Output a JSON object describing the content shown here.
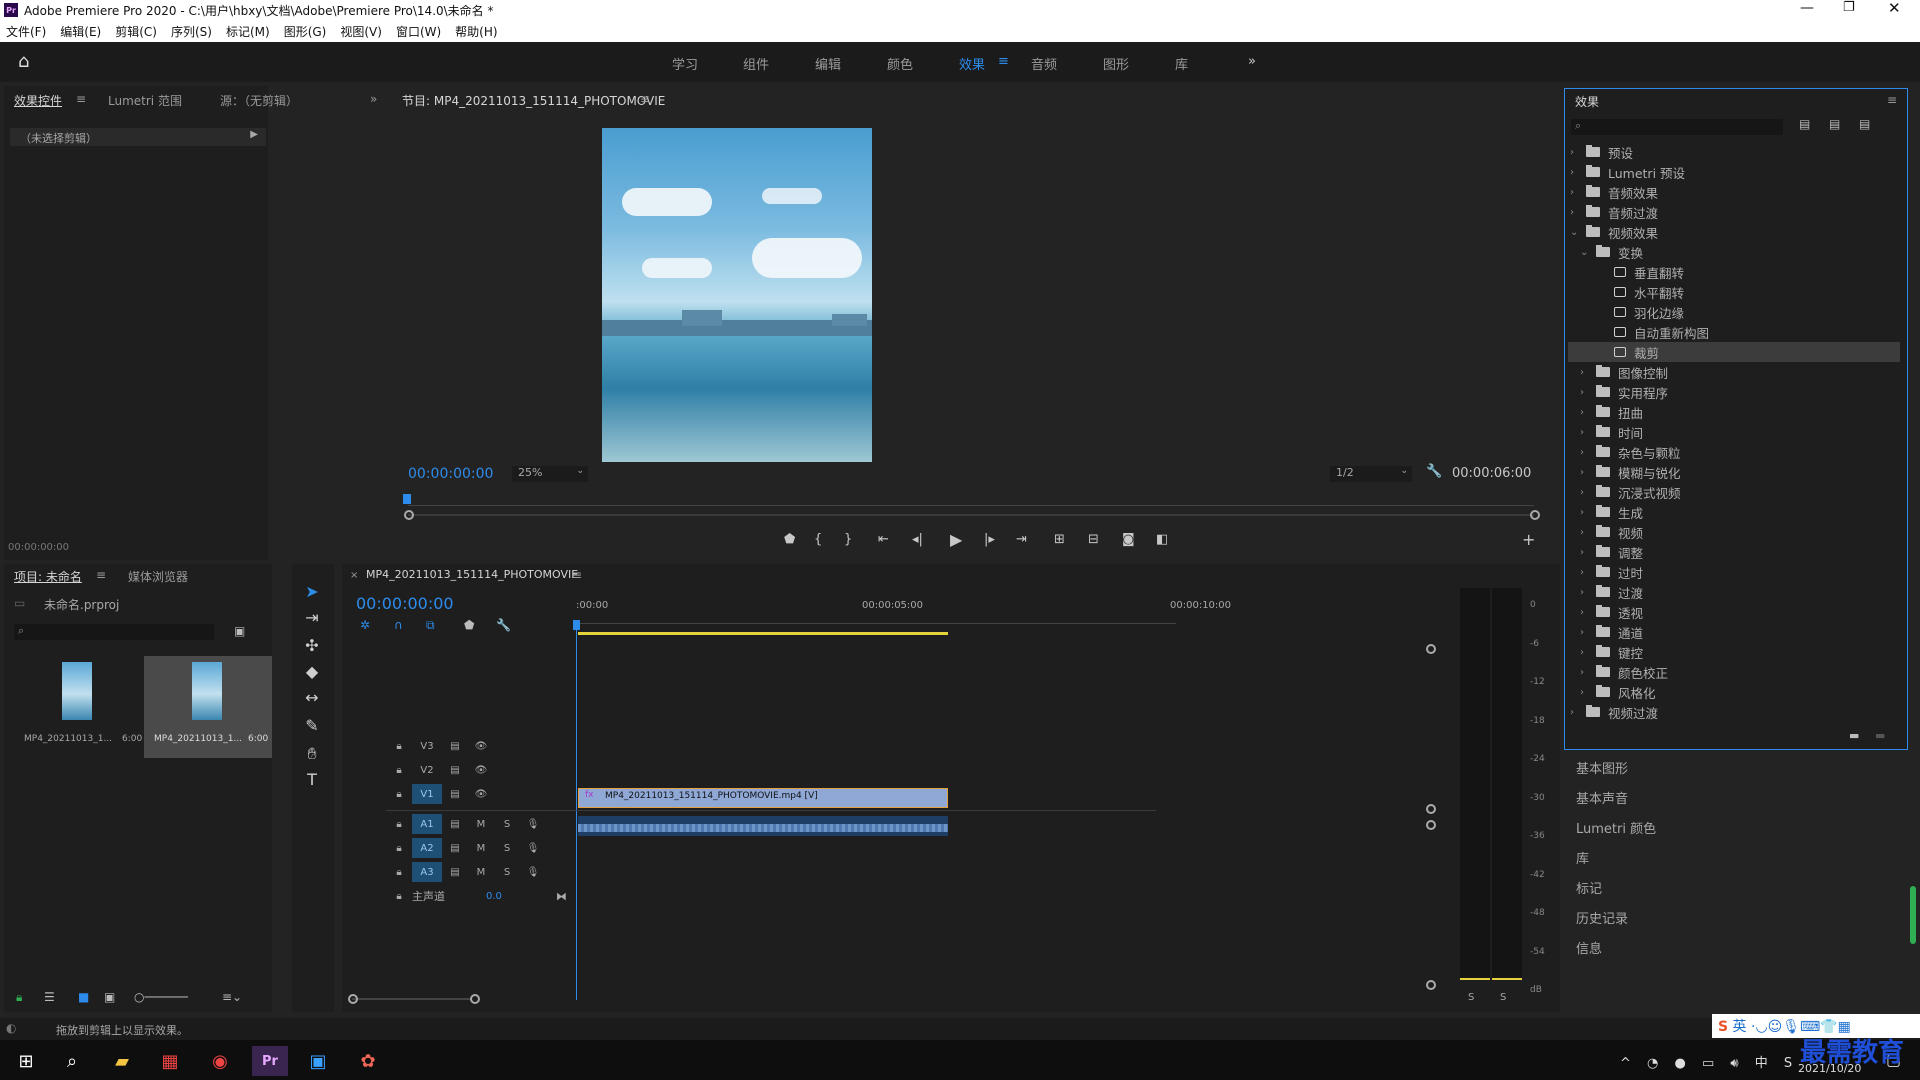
{
  "window": {
    "title": "Adobe Premiere Pro 2020 - C:\\用户\\hbxy\\文档\\Adobe\\Premiere Pro\\14.0\\未命名 *"
  },
  "menu": [
    "文件(F)",
    "编辑(E)",
    "剪辑(C)",
    "序列(S)",
    "标记(M)",
    "图形(G)",
    "视图(V)",
    "窗口(W)",
    "帮助(H)"
  ],
  "workspaces": [
    "学习",
    "组件",
    "编辑",
    "颜色",
    "效果",
    "音频",
    "图形",
    "库"
  ],
  "active_workspace": "效果",
  "source_panel": {
    "tabs": [
      "效果控件",
      "Lumetri 范围",
      "源：（无剪辑）"
    ],
    "no_clip": "（未选择剪辑）",
    "timecode": "00:00:00:00"
  },
  "program": {
    "title": "节目: MP4_20211013_151114_PHOTOMOVIE",
    "timecode": "00:00:00:00",
    "zoom": "25%",
    "resolution": "1/2",
    "duration": "00:00:06:00"
  },
  "effects": {
    "title": "效果",
    "tree": [
      {
        "label": "预设",
        "level": 0,
        "kind": "folder-star",
        "open": false
      },
      {
        "label": "Lumetri 预设",
        "level": 0,
        "kind": "folder-star",
        "open": false
      },
      {
        "label": "音频效果",
        "level": 0,
        "kind": "folder",
        "open": false
      },
      {
        "label": "音频过渡",
        "level": 0,
        "kind": "folder",
        "open": false
      },
      {
        "label": "视频效果",
        "level": 0,
        "kind": "folder",
        "open": true
      },
      {
        "label": "变换",
        "level": 1,
        "kind": "folder",
        "open": true
      },
      {
        "label": "垂直翻转",
        "level": 2,
        "kind": "fx"
      },
      {
        "label": "水平翻转",
        "level": 2,
        "kind": "fx"
      },
      {
        "label": "羽化边缘",
        "level": 2,
        "kind": "fx"
      },
      {
        "label": "自动重新构图",
        "level": 2,
        "kind": "fx"
      },
      {
        "label": "裁剪",
        "level": 2,
        "kind": "fx",
        "selected": true
      },
      {
        "label": "图像控制",
        "level": 1,
        "kind": "folder"
      },
      {
        "label": "实用程序",
        "level": 1,
        "kind": "folder"
      },
      {
        "label": "扭曲",
        "level": 1,
        "kind": "folder"
      },
      {
        "label": "时间",
        "level": 1,
        "kind": "folder"
      },
      {
        "label": "杂色与颗粒",
        "level": 1,
        "kind": "folder"
      },
      {
        "label": "模糊与锐化",
        "level": 1,
        "kind": "folder"
      },
      {
        "label": "沉浸式视频",
        "level": 1,
        "kind": "folder"
      },
      {
        "label": "生成",
        "level": 1,
        "kind": "folder"
      },
      {
        "label": "视频",
        "level": 1,
        "kind": "folder"
      },
      {
        "label": "调整",
        "level": 1,
        "kind": "folder"
      },
      {
        "label": "过时",
        "level": 1,
        "kind": "folder"
      },
      {
        "label": "过渡",
        "level": 1,
        "kind": "folder"
      },
      {
        "label": "透视",
        "level": 1,
        "kind": "folder"
      },
      {
        "label": "通道",
        "level": 1,
        "kind": "folder"
      },
      {
        "label": "键控",
        "level": 1,
        "kind": "folder"
      },
      {
        "label": "颜色校正",
        "level": 1,
        "kind": "folder"
      },
      {
        "label": "风格化",
        "level": 1,
        "kind": "folder"
      },
      {
        "label": "视频过渡",
        "level": 0,
        "kind": "folder",
        "open": false
      }
    ]
  },
  "side_panels": [
    "基本图形",
    "基本声音",
    "Lumetri 颜色",
    "库",
    "标记",
    "历史记录",
    "信息"
  ],
  "project": {
    "tabs": [
      "项目: 未命名",
      "媒体浏览器"
    ],
    "file": "未命名.prproj",
    "items": [
      {
        "name": "MP4_20211013_1...",
        "dur": "6:00"
      },
      {
        "name": "MP4_20211013_1...",
        "dur": "6:00"
      }
    ]
  },
  "timeline": {
    "tab": "MP4_20211013_151114_PHOTOMOVIE",
    "timecode": "00:00:00:00",
    "ruler": [
      ":00:00",
      "00:00:05:00",
      "00:00:10:00"
    ],
    "video_tracks": [
      "V3",
      "V2",
      "V1"
    ],
    "audio_tracks": [
      "A1",
      "A2",
      "A3"
    ],
    "master": "主声道",
    "master_val": "0.0",
    "clip_label": "MP4_20211013_151114_PHOTOMOVIE.mp4 [V]"
  },
  "meter": {
    "labels": [
      "0",
      "-6",
      "-12",
      "-18",
      "-24",
      "-30",
      "-36",
      "-42",
      "-48",
      "-54",
      "dB"
    ],
    "solo": [
      "S",
      "S"
    ]
  },
  "status": "拖放到剪辑上以显示效果。",
  "taskbar": {
    "date": "2021/10/20",
    "ime": "英",
    "watermark": "最需教育"
  },
  "colors": {
    "accent": "#2d8ceb",
    "clip": "#8fa8d6",
    "yellow": "#e6d23c"
  }
}
